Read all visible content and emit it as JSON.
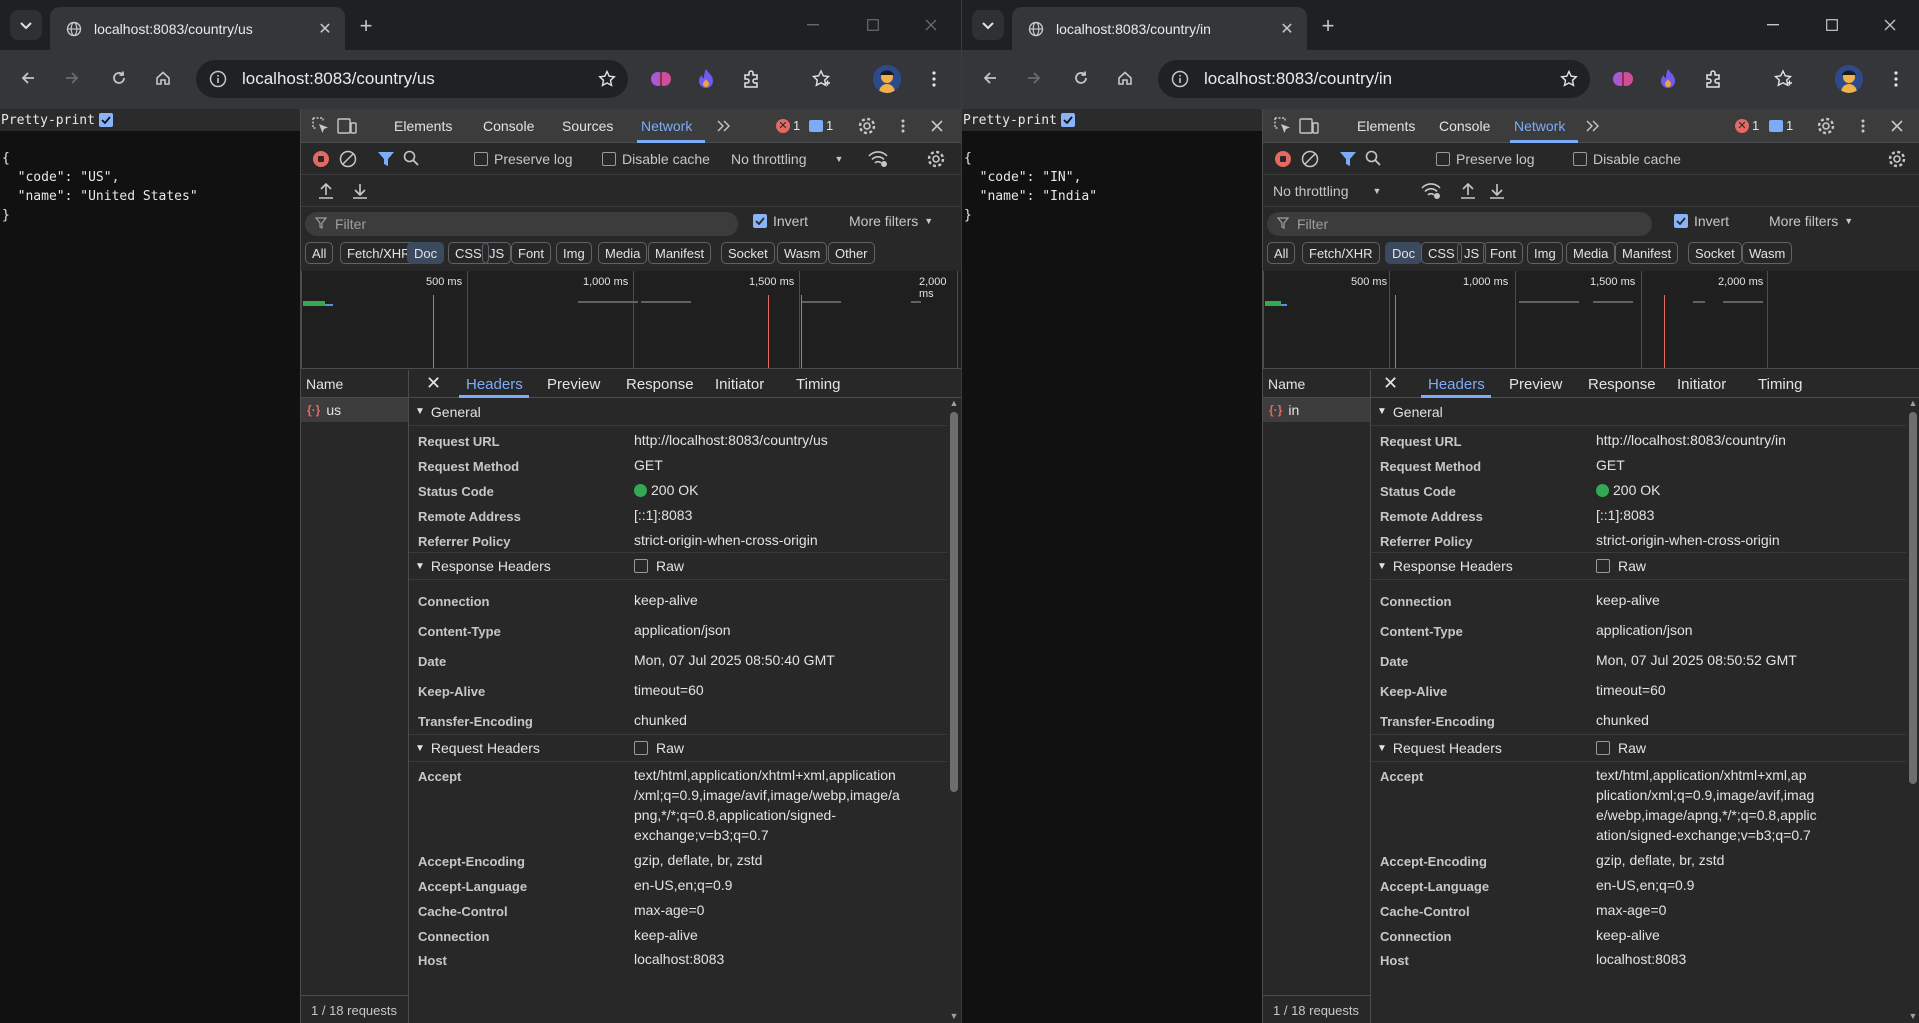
{
  "windows": [
    {
      "id": "left",
      "tab_title": "localhost:8083/country/us",
      "url": "localhost:8083/country/us",
      "page": {
        "pretty_print_label": "Pretty-print",
        "json_lines": [
          "{",
          "  \"code\": \"US\",",
          "  \"name\": \"United States\"",
          "}"
        ]
      },
      "devtools": {
        "tabs": [
          "Elements",
          "Console",
          "Sources",
          "Network"
        ],
        "active_tab": "Network",
        "error_count": "1",
        "message_count": "1",
        "preserve_log": "Preserve log",
        "disable_cache": "Disable cache",
        "throttling": "No throttling",
        "filter_placeholder": "Filter",
        "invert": "Invert",
        "more_filters": "More filters",
        "type_filters": [
          "All",
          "Fetch/XHR",
          "Doc",
          "CSS",
          "JS",
          "Font",
          "Img",
          "Media",
          "Manifest",
          "Socket",
          "Wasm",
          "Other"
        ],
        "active_type": "Doc",
        "timeline_labels": [
          "500 ms",
          "1,000 ms",
          "1,500 ms",
          "2,000 ms"
        ],
        "name_header": "Name",
        "request_name": "us",
        "footer": "1 / 18 requests",
        "detail_tabs": [
          "Headers",
          "Preview",
          "Response",
          "Initiator",
          "Timing"
        ],
        "general_title": "General",
        "general": [
          {
            "k": "Request URL",
            "v": "http://localhost:8083/country/us"
          },
          {
            "k": "Request Method",
            "v": "GET"
          },
          {
            "k": "Status Code",
            "v": "200 OK"
          },
          {
            "k": "Remote Address",
            "v": "[::1]:8083"
          },
          {
            "k": "Referrer Policy",
            "v": "strict-origin-when-cross-origin"
          }
        ],
        "response_title": "Response Headers",
        "raw_label": "Raw",
        "response": [
          {
            "k": "Connection",
            "v": "keep-alive"
          },
          {
            "k": "Content-Type",
            "v": "application/json"
          },
          {
            "k": "Date",
            "v": "Mon, 07 Jul 2025 08:50:40 GMT"
          },
          {
            "k": "Keep-Alive",
            "v": "timeout=60"
          },
          {
            "k": "Transfer-Encoding",
            "v": "chunked"
          }
        ],
        "request_title": "Request Headers",
        "request": [
          {
            "k": "Accept",
            "v": "text/html,application/xhtml+xml,application\n/xml;q=0.9,image/avif,image/webp,image/a\npng,*/*;q=0.8,application/signed-\nexchange;v=b3;q=0.7"
          },
          {
            "k": "Accept-Encoding",
            "v": "gzip, deflate, br, zstd"
          },
          {
            "k": "Accept-Language",
            "v": "en-US,en;q=0.9"
          },
          {
            "k": "Cache-Control",
            "v": "max-age=0"
          },
          {
            "k": "Connection",
            "v": "keep-alive"
          },
          {
            "k": "Host",
            "v": "localhost:8083"
          }
        ]
      }
    },
    {
      "id": "right",
      "tab_title": "localhost:8083/country/in",
      "url": "localhost:8083/country/in",
      "page": {
        "pretty_print_label": "Pretty-print",
        "json_lines": [
          "{",
          "  \"code\": \"IN\",",
          "  \"name\": \"India\"",
          "}"
        ]
      },
      "devtools": {
        "tabs": [
          "Elements",
          "Console",
          "Network"
        ],
        "active_tab": "Network",
        "error_count": "1",
        "message_count": "1",
        "preserve_log": "Preserve log",
        "disable_cache": "Disable cache",
        "throttling": "No throttling",
        "filter_placeholder": "Filter",
        "invert": "Invert",
        "more_filters": "More filters",
        "type_filters": [
          "All",
          "Fetch/XHR",
          "Doc",
          "CSS",
          "JS",
          "Font",
          "Img",
          "Media",
          "Manifest",
          "Socket",
          "Wasm"
        ],
        "active_type": "Doc",
        "timeline_labels": [
          "500 ms",
          "1,000 ms",
          "1,500 ms",
          "2,000 ms"
        ],
        "name_header": "Name",
        "request_name": "in",
        "footer": "1 / 18 requests",
        "detail_tabs": [
          "Headers",
          "Preview",
          "Response",
          "Initiator",
          "Timing"
        ],
        "general_title": "General",
        "general": [
          {
            "k": "Request URL",
            "v": "http://localhost:8083/country/in"
          },
          {
            "k": "Request Method",
            "v": "GET"
          },
          {
            "k": "Status Code",
            "v": "200 OK"
          },
          {
            "k": "Remote Address",
            "v": "[::1]:8083"
          },
          {
            "k": "Referrer Policy",
            "v": "strict-origin-when-cross-origin"
          }
        ],
        "response_title": "Response Headers",
        "raw_label": "Raw",
        "response": [
          {
            "k": "Connection",
            "v": "keep-alive"
          },
          {
            "k": "Content-Type",
            "v": "application/json"
          },
          {
            "k": "Date",
            "v": "Mon, 07 Jul 2025 08:50:52 GMT"
          },
          {
            "k": "Keep-Alive",
            "v": "timeout=60"
          },
          {
            "k": "Transfer-Encoding",
            "v": "chunked"
          }
        ],
        "request_title": "Request Headers",
        "request": [
          {
            "k": "Accept",
            "v": "text/html,application/xhtml+xml,ap\nplication/xml;q=0.9,image/avif,imag\ne/webp,image/apng,*/*;q=0.8,applic\nation/signed-exchange;v=b3;q=0.7"
          },
          {
            "k": "Accept-Encoding",
            "v": "gzip, deflate, br, zstd"
          },
          {
            "k": "Accept-Language",
            "v": "en-US,en;q=0.9"
          },
          {
            "k": "Cache-Control",
            "v": "max-age=0"
          },
          {
            "k": "Connection",
            "v": "keep-alive"
          },
          {
            "k": "Host",
            "v": "localhost:8083"
          }
        ]
      }
    }
  ],
  "colors": {
    "accent": "#7cacf8",
    "error": "#e46962",
    "status_ok": "#34a853"
  }
}
